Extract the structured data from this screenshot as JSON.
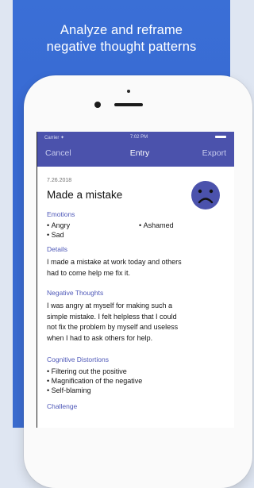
{
  "headline": {
    "line1": "Analyze and reframe",
    "line2": "negative thought patterns"
  },
  "status_bar": {
    "carrier": "Carrier ✦",
    "time": "7:02 PM"
  },
  "nav": {
    "cancel": "Cancel",
    "title": "Entry",
    "export": "Export"
  },
  "entry": {
    "date": "7.26.2018",
    "title": "Made a mistake",
    "mood_icon": "sad-face-icon",
    "mood_color": "#4b52ac"
  },
  "sections": {
    "emotions": {
      "label": "Emotions",
      "items": [
        "Angry",
        "Ashamed",
        "Sad"
      ]
    },
    "details": {
      "label": "Details",
      "lines": [
        "I made a mistake at work today and others",
        "had to come help me fix it."
      ]
    },
    "negative_thoughts": {
      "label": "Negative Thoughts",
      "lines": [
        "I was angry at myself for making such a",
        "simple mistake. I felt helpless that I could",
        "not fix the problem by myself and useless",
        "when I had to ask others for help."
      ]
    },
    "cognitive_distortions": {
      "label": "Cognitive Distortions",
      "items": [
        "Filtering out the positive",
        "Magnification of the negative",
        "Self-blaming"
      ]
    },
    "challenge": {
      "label": "Challenge"
    }
  }
}
